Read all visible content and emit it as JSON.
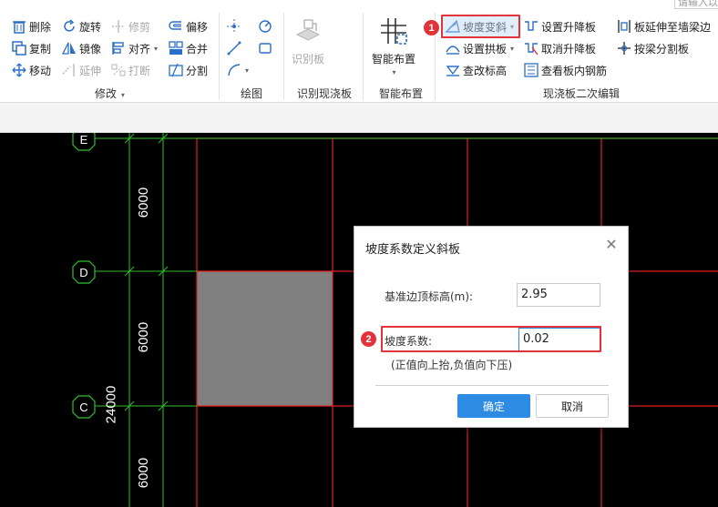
{
  "search": {
    "placeholder": "请输入以"
  },
  "ribbon": {
    "modify": {
      "label": "修改",
      "buttons": {
        "delete": "删除",
        "rotate": "旋转",
        "trim": "修剪",
        "offset": "偏移",
        "copy": "复制",
        "mirror": "镜像",
        "align": "对齐",
        "merge": "合并",
        "move": "移动",
        "extend": "延伸",
        "break": "打断",
        "split": "分割"
      }
    },
    "draw": {
      "label": "绘图"
    },
    "recognize": {
      "label": "识别现浇板",
      "button": "识别板"
    },
    "smart": {
      "label": "智能布置",
      "button": "智能布置"
    },
    "edit": {
      "label": "现浇板二次编辑",
      "buttons": {
        "slope_change": "坡度变斜",
        "set_arch": "设置拱板",
        "check_elevation": "查改标高",
        "set_raise": "设置升降板",
        "cancel_raise": "取消升降板",
        "view_rebar": "查看板内钢筋",
        "extend_to_wall": "板延伸至墙梁边",
        "split_by_beam": "按梁分割板"
      }
    },
    "badge_1": "1"
  },
  "canvas": {
    "axes": [
      "E",
      "D",
      "C"
    ],
    "dims": [
      "6000",
      "6000",
      "24000",
      "6000"
    ],
    "colors": {
      "grid_red": "#e0222a",
      "grid_green": "#2fbf2f",
      "slab_fill": "#808080",
      "background": "#000000"
    }
  },
  "dialog": {
    "title": "坡度系数定义斜板",
    "base_height_label": "基准边顶标高(m):",
    "base_height_value": "2.95",
    "slope_label": "坡度系数:",
    "slope_value": "0.02",
    "hint": "(正值向上抬,负值向下压)",
    "ok": "确定",
    "cancel": "取消",
    "badge_2": "2"
  }
}
